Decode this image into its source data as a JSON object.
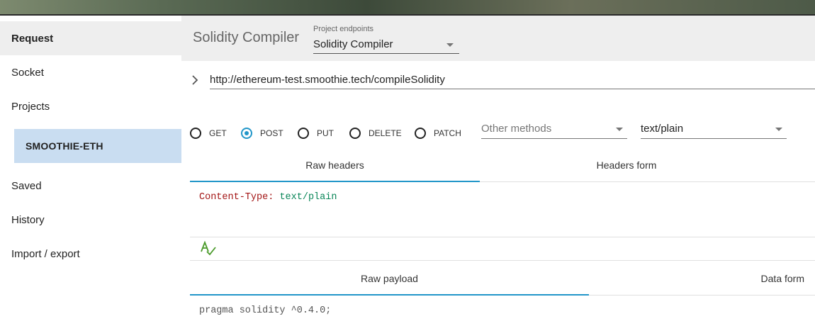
{
  "sidebar": {
    "items": [
      {
        "label": "Request"
      },
      {
        "label": "Socket"
      },
      {
        "label": "Projects"
      },
      {
        "label": "SMOOTHIE-ETH"
      },
      {
        "label": "Saved"
      },
      {
        "label": "History"
      },
      {
        "label": "Import / export"
      }
    ]
  },
  "header": {
    "title": "Solidity Compiler",
    "endpoints_label": "Project endpoints",
    "endpoints_value": "Solidity Compiler"
  },
  "url": {
    "value": "http://ethereum-test.smoothie.tech/compileSolidity"
  },
  "methods": {
    "options": [
      "GET",
      "POST",
      "PUT",
      "DELETE",
      "PATCH"
    ],
    "selected": "POST",
    "other_placeholder": "Other methods",
    "content_type": "text/plain"
  },
  "headers_tabs": [
    "Raw headers",
    "Headers form"
  ],
  "headers_content": {
    "key": "Content-Type:",
    "value": "text/plain"
  },
  "payload_tabs": [
    "Raw payload",
    "Data form"
  ],
  "payload_content": "pragma solidity ^0.4.0;",
  "colors": {
    "accent": "#2196c9",
    "selected_project_bg": "#c9ddf1",
    "header_bg": "#eeeeee"
  }
}
